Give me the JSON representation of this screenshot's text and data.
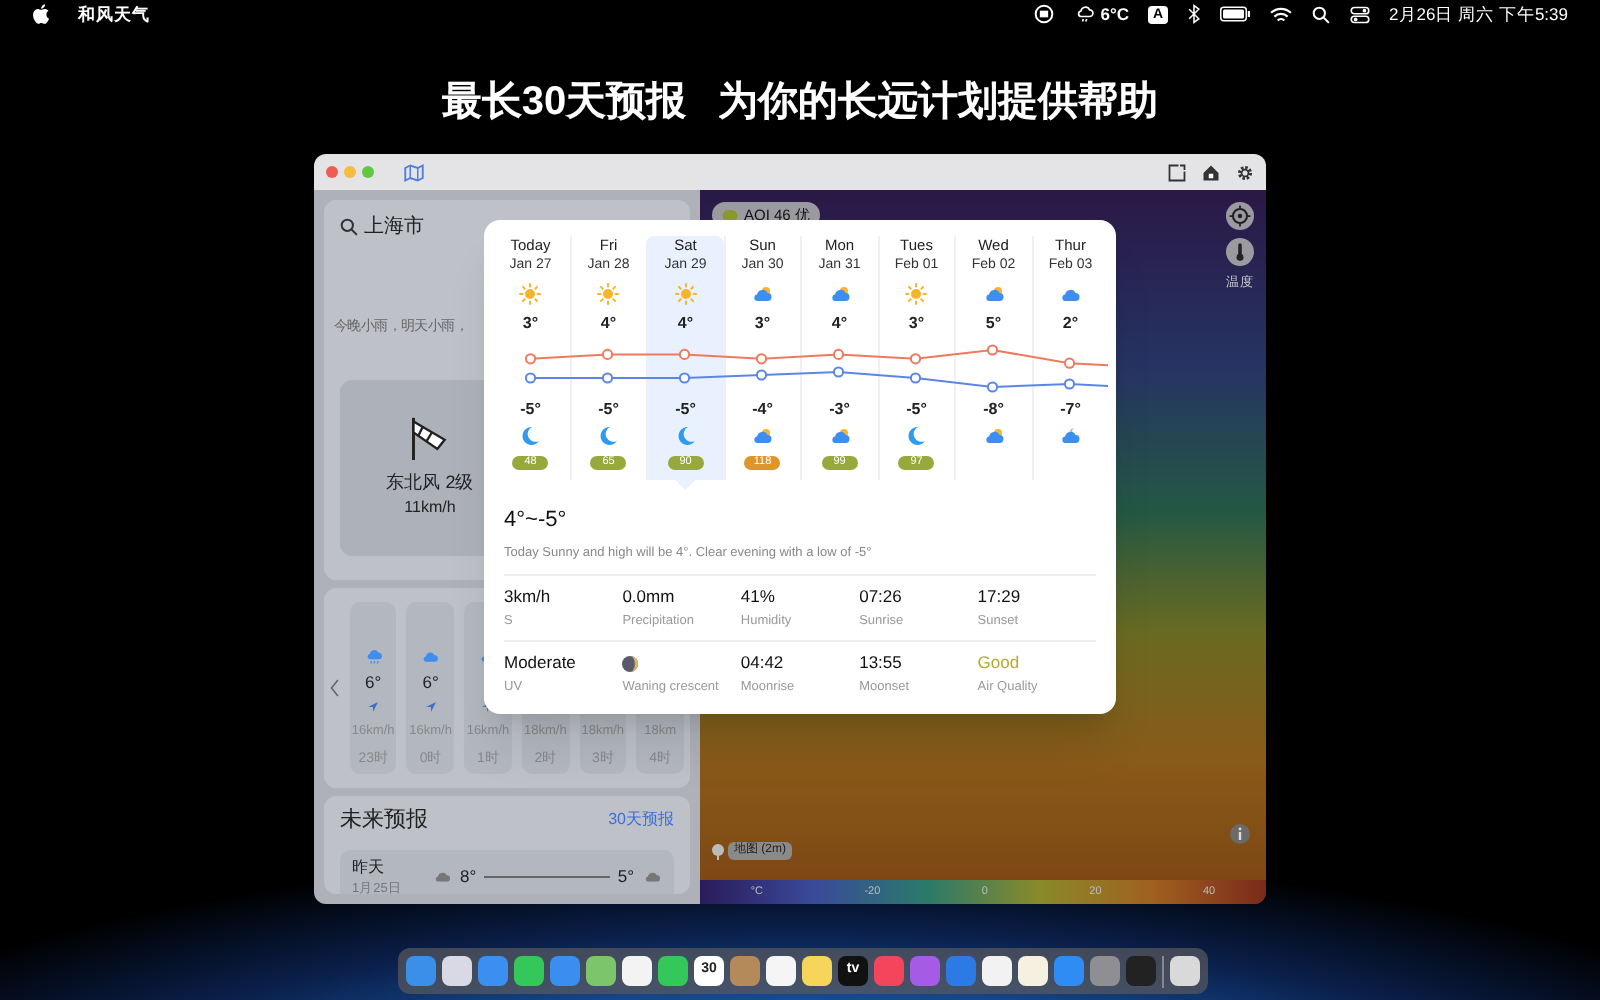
{
  "menu_bar": {
    "app_name": "和风天气",
    "weather": "6°C",
    "input_source": "A",
    "clock": "2月26日 周六 下午5:39"
  },
  "headline": [
    "最长30天预报",
    "为你的长远计划提供帮助"
  ],
  "sidebar": {
    "city": "上海市",
    "summary": "今晚小雨，明天小雨，",
    "wind": {
      "direction": "东北风 2级",
      "speed": "11km/h"
    },
    "hourly": [
      {
        "kind": "rain",
        "temp": "6°",
        "wind": "16km/h",
        "time": "23时"
      },
      {
        "kind": "cloud",
        "temp": "6°",
        "wind": "16km/h",
        "time": "0时"
      },
      {
        "kind": "cloud",
        "wind": "16km/h",
        "time": "1时"
      },
      {
        "kind": "hidden",
        "wind": "18km/h",
        "time": "2时"
      },
      {
        "kind": "hidden",
        "wind": "18km/h",
        "time": "3时"
      },
      {
        "kind": "hidden",
        "wind": "18km",
        "time": "4时"
      }
    ],
    "forecast": {
      "title": "未来预报",
      "link": "30天预报",
      "rows": [
        {
          "day": "昨天",
          "date": "1月25日",
          "high": "8°",
          "low": "5°"
        }
      ]
    }
  },
  "map": {
    "aqi": "AQI 46 优",
    "layer_label": "温度",
    "map_label": "地图 (2m)",
    "scale": [
      "°C",
      "-20",
      "0",
      "20",
      "40"
    ]
  },
  "popup": {
    "days": [
      {
        "name": "Today",
        "date": "Jan 27",
        "day": {
          "kind": "sun",
          "temp": "3°"
        },
        "night": {
          "kind": "moon",
          "temp": "-5°"
        },
        "aqi": {
          "value": "48",
          "color": "#97a93c"
        },
        "selected": false
      },
      {
        "name": "Fri",
        "date": "Jan 28",
        "day": {
          "kind": "sun",
          "temp": "4°"
        },
        "night": {
          "kind": "moon",
          "temp": "-5°"
        },
        "aqi": {
          "value": "65",
          "color": "#97a93c"
        },
        "selected": false
      },
      {
        "name": "Sat",
        "date": "Jan 29",
        "day": {
          "kind": "sun",
          "temp": "4°"
        },
        "night": {
          "kind": "moon",
          "temp": "-5°"
        },
        "aqi": {
          "value": "90",
          "color": "#97a93c"
        },
        "selected": true
      },
      {
        "name": "Sun",
        "date": "Jan 30",
        "day": {
          "kind": "cloud_sun",
          "temp": "3°"
        },
        "night": {
          "kind": "cloud_sun",
          "temp": "-4°"
        },
        "aqi": {
          "value": "118",
          "color": "#e0952a"
        },
        "selected": false
      },
      {
        "name": "Mon",
        "date": "Jan 31",
        "day": {
          "kind": "cloud_sun",
          "temp": "4°"
        },
        "night": {
          "kind": "cloud_sun",
          "temp": "-3°"
        },
        "aqi": {
          "value": "99",
          "color": "#97a93c"
        },
        "selected": false
      },
      {
        "name": "Tues",
        "date": "Feb 01",
        "day": {
          "kind": "sun",
          "temp": "3°"
        },
        "night": {
          "kind": "moon",
          "temp": "-5°"
        },
        "aqi": {
          "value": "97",
          "color": "#97a93c"
        },
        "selected": false
      },
      {
        "name": "Wed",
        "date": "Feb 02",
        "day": {
          "kind": "cloud_sun",
          "temp": "5°"
        },
        "night": {
          "kind": "cloud_sun",
          "temp": "-8°"
        },
        "selected": false
      },
      {
        "name": "Thur",
        "date": "Feb 03",
        "day": {
          "kind": "cloud",
          "temp": "2°"
        },
        "night": {
          "kind": "cloud_moon",
          "temp": "-7°"
        },
        "selected": false
      }
    ],
    "range": "4°~-5°",
    "description": "Today Sunny and high will be 4°. Clear evening with a low of -5°",
    "stats": [
      {
        "kind": "value",
        "value": "3km/h",
        "label": "S"
      },
      {
        "kind": "value",
        "value": "0.0mm",
        "label": "Precipitation"
      },
      {
        "kind": "value",
        "value": "41%",
        "label": "Humidity"
      },
      {
        "kind": "value",
        "value": "07:26",
        "label": "Sunrise"
      },
      {
        "kind": "value",
        "value": "17:29",
        "label": "Sunset"
      },
      {
        "kind": "value",
        "value": "Moderate",
        "label": "UV"
      },
      {
        "kind": "moon_phase",
        "label": "Waning crescent"
      },
      {
        "kind": "value",
        "value": "04:42",
        "label": "Moonrise"
      },
      {
        "kind": "value",
        "value": "13:55",
        "label": "Moonset"
      },
      {
        "kind": "value",
        "value": "Good",
        "label": "Air Quality",
        "color": "#b5a92c"
      }
    ]
  },
  "dock": [
    {
      "color": "#3b8fe8"
    },
    {
      "color": "#d9d9e6"
    },
    {
      "color": "#3b8ff0"
    },
    {
      "color": "#34c759"
    },
    {
      "color": "#3a8ef0"
    },
    {
      "color": "#7cc56a"
    },
    {
      "color": "#f3f3f3"
    },
    {
      "color": "#34c759"
    },
    {
      "color": "#ffffff",
      "label": "30"
    },
    {
      "color": "#b58a5a"
    },
    {
      "color": "#f5f5f5"
    },
    {
      "color": "#f7d55a"
    },
    {
      "color": "#111111",
      "label": "tv"
    },
    {
      "color": "#f5455c"
    },
    {
      "color": "#a65be6"
    },
    {
      "color": "#2c7be5"
    },
    {
      "color": "#f2f2f2"
    },
    {
      "color": "#f5f0e0"
    },
    {
      "color": "#2f8cf5"
    },
    {
      "color": "#8e8e93"
    },
    {
      "color": "#222222"
    },
    {
      "color": "#d9d9d9"
    }
  ]
}
